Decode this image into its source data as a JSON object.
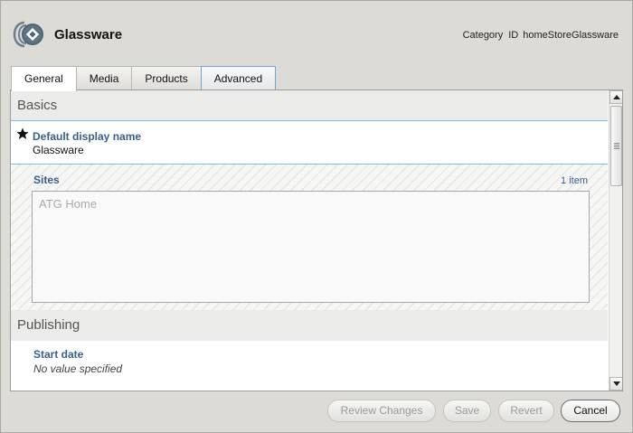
{
  "header": {
    "title": "Glassware",
    "category_label": "Category",
    "id_label": "ID",
    "id_value": "homeStoreGlassware",
    "icon": "category-icon"
  },
  "tabs": [
    {
      "label": "General",
      "active": true
    },
    {
      "label": "Media",
      "active": false
    },
    {
      "label": "Products",
      "active": false
    },
    {
      "label": "Advanced",
      "active": false
    }
  ],
  "basics": {
    "heading": "Basics",
    "display_name": {
      "label": "Default display name",
      "value": "Glassware",
      "required_icon": "star-icon"
    },
    "sites": {
      "label": "Sites",
      "count": "1 item",
      "items": [
        "ATG Home"
      ]
    }
  },
  "publishing": {
    "heading": "Publishing",
    "start_date": {
      "label": "Start date",
      "value": "No value specified"
    }
  },
  "buttons": {
    "review": "Review Changes",
    "save": "Save",
    "revert": "Revert",
    "cancel": "Cancel"
  },
  "colors": {
    "field_label": "#3c5d90",
    "section_divider": "#7fc0e8",
    "background": "#dcdbd5"
  }
}
